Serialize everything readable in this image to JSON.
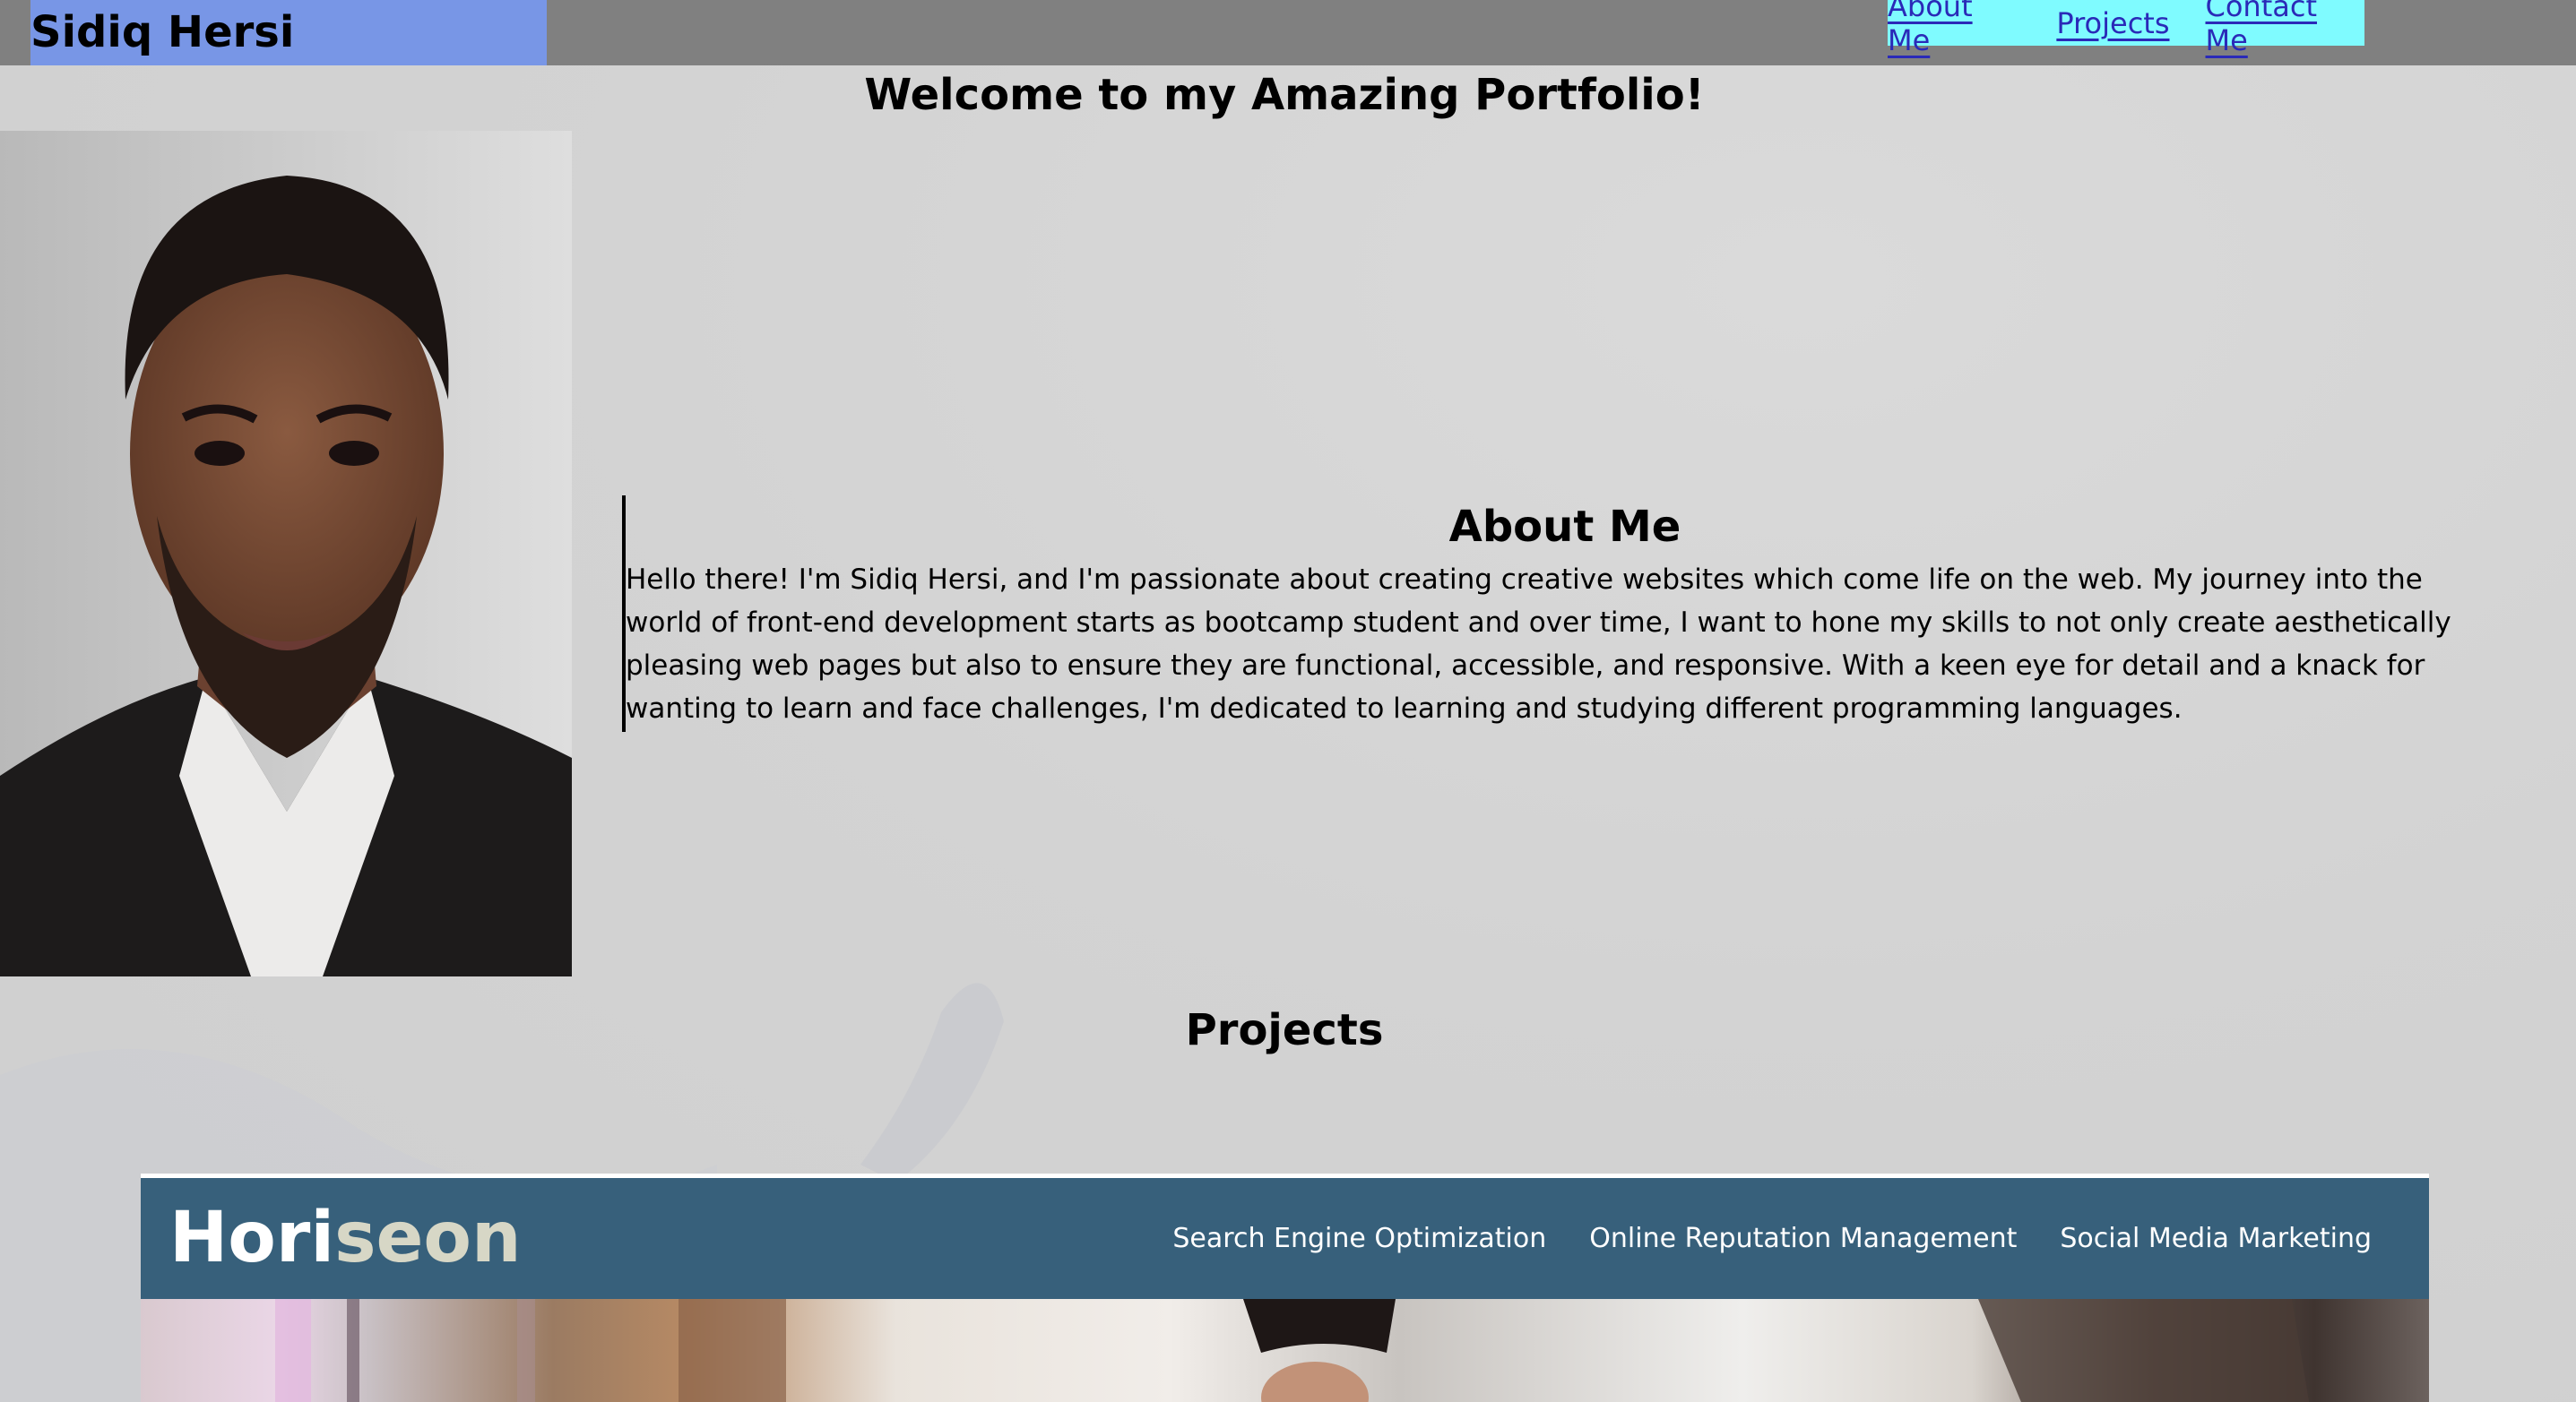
{
  "header": {
    "brand": "Sidiq Hersi",
    "nav": [
      "About Me",
      "Projects",
      "Contact Me"
    ]
  },
  "welcome": "Welcome to my Amazing Portfolio!",
  "about": {
    "title": "About Me",
    "body": "Hello there! I'm Sidiq Hersi, and I'm passionate about creating creative websites which come life on the web. My journey into the world of front-end development starts as bootcamp student and over time, I want to hone my skills to not only create aesthetically pleasing web pages but also to ensure they are functional, accessible, and responsive. With a keen eye for detail and a knack for wanting to learn and face challenges, I'm dedicated to learning and studying different programming languages."
  },
  "projects": {
    "title": "Projects",
    "card": {
      "logo_part1": "Hori",
      "logo_part2": "seon",
      "links": [
        "Search Engine Optimization",
        "Online Reputation Management",
        "Social Media Marketing"
      ]
    }
  },
  "colors": {
    "header_bg": "#808080",
    "brand_bg": "#7896e6",
    "nav_bg": "#7ffbff",
    "link": "#2a2ab8",
    "project_nav_bg": "#37607b"
  }
}
